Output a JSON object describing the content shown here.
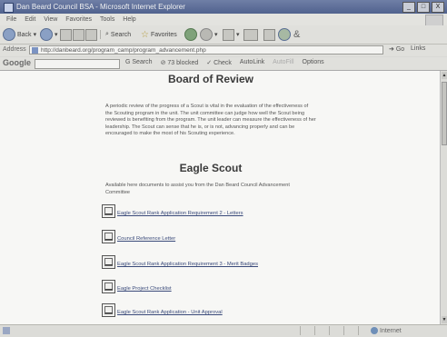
{
  "window": {
    "title": "Dan Beard Council BSA - Microsoft Internet Explorer",
    "controls": [
      "_",
      "□",
      "X"
    ]
  },
  "menu": [
    "File",
    "Edit",
    "View",
    "Favorites",
    "Tools",
    "Help"
  ],
  "toolbar": {
    "back": "Back",
    "search": "Search",
    "favorites": "Favorites"
  },
  "address": {
    "label": "Address",
    "url": "http://danbeard.org/program_camp/program_advancement.php",
    "go": "Go",
    "links": "Links"
  },
  "googlebar": {
    "logo": "Google",
    "search": "Search",
    "blocked": "73 blocked",
    "check": "Check",
    "autolink": "AutoLink",
    "autofill": "AutoFill",
    "options": "Options"
  },
  "page": {
    "board_heading": "Board of Review",
    "board_text": "A periodic review of the progress of a Scout is vital in the evaluation of the effectiveness of the Scouting program in the unit. The unit committee can judge how well the Scout being reviewed is benefiting from the program. The unit leader can measure the effectiveness of her leadership. The Scout can sense that he is, or is not, advancing properly and can be encouraged to make the most of his Scouting experience.",
    "eagle_heading": "Eagle Scout",
    "eagle_text": "Available here documents to assist you from the Dan Beard Council Advancement Committee",
    "documents": [
      "Eagle Scout Rank Application Requirement 2 - Letters",
      "Council Reference Letter",
      "Eagle Scout Rank Application Requirement 3 - Merit Badges",
      "Eagle Project Checklist",
      "Eagle Scout Rank Application - Unit Approval"
    ]
  },
  "status": {
    "zone": "Internet"
  }
}
